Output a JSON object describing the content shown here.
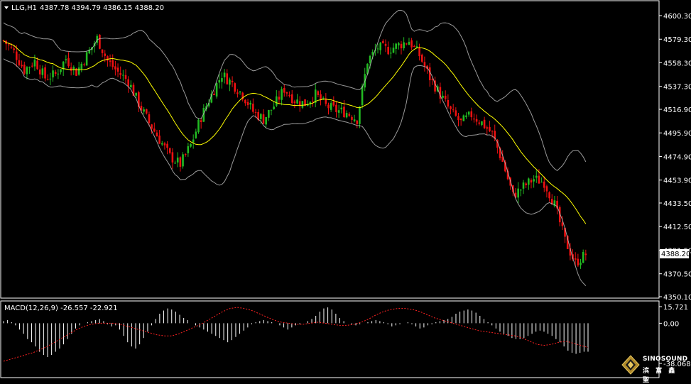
{
  "header": {
    "symbol": "LLG,H1",
    "ohlc": "4387.78 4394.79 4386.15 4388.20"
  },
  "price_axis": {
    "ticks": [
      "4600.30",
      "4579.30",
      "4558.30",
      "4537.30",
      "4516.90",
      "4495.90",
      "4474.90",
      "4453.90",
      "4433.50",
      "4412.50",
      "4391.50",
      "4370.50",
      "4350.10"
    ],
    "current_price": "4388.20"
  },
  "macd": {
    "title": "MACD(12,26,9) -26.557 -22.921",
    "ticks": [
      "15.721",
      "0.00",
      "-38.068"
    ]
  },
  "watermark": {
    "brand": "SINOSOUND",
    "sub": "滨 富 鑫 聖"
  },
  "colors": {
    "bull": "#22bb22",
    "bear": "#ee1111",
    "ma": "#ffff00",
    "bands": "#c0c0c0",
    "macd_hist": "#ffffff",
    "macd_signal": "#ff2222",
    "frame": "#ffffff"
  },
  "chart_data": {
    "type": "candlestick",
    "timeframe": "H1",
    "indicators": [
      "Bollinger Bands",
      "Moving Average",
      "MACD(12,26,9)"
    ],
    "ylim": [
      4350.1,
      4600.3
    ],
    "close_path": [
      [
        0,
        4578
      ],
      [
        4,
        4568
      ],
      [
        8,
        4552
      ],
      [
        12,
        4560
      ],
      [
        16,
        4545
      ],
      [
        20,
        4548
      ],
      [
        24,
        4562
      ],
      [
        28,
        4550
      ],
      [
        32,
        4565
      ],
      [
        36,
        4580
      ],
      [
        40,
        4560
      ],
      [
        44,
        4550
      ],
      [
        48,
        4542
      ],
      [
        52,
        4522
      ],
      [
        56,
        4505
      ],
      [
        60,
        4490
      ],
      [
        64,
        4475
      ],
      [
        68,
        4468
      ],
      [
        72,
        4485
      ],
      [
        76,
        4510
      ],
      [
        80,
        4530
      ],
      [
        84,
        4548
      ],
      [
        88,
        4540
      ],
      [
        92,
        4530
      ],
      [
        96,
        4515
      ],
      [
        100,
        4508
      ],
      [
        104,
        4520
      ],
      [
        108,
        4535
      ],
      [
        112,
        4525
      ],
      [
        116,
        4522
      ],
      [
        120,
        4530
      ],
      [
        124,
        4520
      ],
      [
        128,
        4516
      ],
      [
        132,
        4514
      ],
      [
        136,
        4508
      ],
      [
        140,
        4560
      ],
      [
        144,
        4572
      ],
      [
        148,
        4570
      ],
      [
        152,
        4574
      ],
      [
        156,
        4578
      ],
      [
        160,
        4565
      ],
      [
        164,
        4545
      ],
      [
        168,
        4530
      ],
      [
        172,
        4515
      ],
      [
        176,
        4505
      ],
      [
        180,
        4512
      ],
      [
        184,
        4505
      ],
      [
        188,
        4495
      ],
      [
        192,
        4470
      ],
      [
        196,
        4440
      ],
      [
        200,
        4448
      ],
      [
        204,
        4455
      ],
      [
        208,
        4452
      ],
      [
        212,
        4432
      ],
      [
        216,
        4400
      ],
      [
        220,
        4380
      ],
      [
        224,
        4388
      ]
    ],
    "macd_hist": [
      2,
      3,
      1,
      -2,
      -6,
      -10,
      -15,
      -18,
      -22,
      -27,
      -30,
      -32,
      -30,
      -27,
      -24,
      -20,
      -15,
      -10,
      -5,
      -2,
      0,
      1,
      2,
      3,
      4,
      2,
      -1,
      -3,
      -2,
      -6,
      -12,
      -18,
      -22,
      -24,
      -20,
      -14,
      -8,
      -2,
      4,
      9,
      12,
      14,
      13,
      11,
      8,
      5,
      3,
      0,
      -2,
      -4,
      -6,
      -8,
      -10,
      -12,
      -14,
      -16,
      -18,
      -16,
      -13,
      -10,
      -7,
      -4,
      -1,
      1,
      2,
      3,
      2,
      1,
      0,
      -2,
      -4,
      -6,
      -4,
      -2,
      -1,
      0,
      2,
      4,
      7,
      11,
      14,
      15,
      13,
      9,
      5,
      2,
      0,
      -1,
      -2,
      -1,
      0,
      1,
      2,
      3,
      2,
      1,
      -1,
      -3,
      -2,
      -1,
      0,
      1,
      -1,
      -3,
      -5,
      -4,
      -2,
      -1,
      1,
      2,
      3,
      4,
      6,
      9,
      11,
      12,
      13,
      12,
      10,
      7,
      4,
      1,
      -2,
      -5,
      -8,
      -10,
      -12,
      -14,
      -15,
      -15,
      -14,
      -12,
      -10,
      -8,
      -7,
      -8,
      -10,
      -12,
      -15,
      -18,
      -22,
      -26,
      -28,
      -29,
      -28,
      -27,
      -27
    ],
    "macd_signal": [
      -36,
      -34,
      -32,
      -30,
      -28,
      -25,
      -22,
      -18,
      -14,
      -10,
      -6,
      -3,
      -1,
      0,
      0,
      0,
      -1,
      -3,
      -5,
      -7,
      -9,
      -11,
      -12,
      -12,
      -10,
      -7,
      -4,
      -1,
      3,
      7,
      11,
      14,
      15,
      14,
      12,
      9,
      6,
      3,
      1,
      0,
      -1,
      -1,
      0,
      1,
      0,
      -1,
      -2,
      -2,
      -1,
      1,
      4,
      8,
      11,
      13,
      14,
      14,
      13,
      11,
      8,
      5,
      3,
      1,
      -1,
      -3,
      -5,
      -7,
      -8,
      -9,
      -10,
      -11,
      -12,
      -14,
      -17,
      -20,
      -21,
      -20,
      -18,
      -17,
      -19,
      -21,
      -23
    ],
    "annotations": [
      "MACD(12,26,9) -26.557 -22.921"
    ]
  }
}
